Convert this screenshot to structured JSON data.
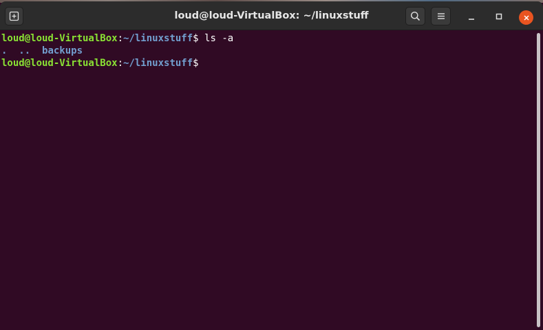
{
  "window": {
    "title": "loud@loud-VirtualBox: ~/linuxstuff"
  },
  "header": {
    "new_tab_icon": "new-tab-icon",
    "search_icon": "search-icon",
    "menu_icon": "hamburger-menu-icon",
    "minimize_icon": "minimize-icon",
    "maximize_icon": "maximize-icon",
    "close_icon": "close-icon"
  },
  "terminal": {
    "lines": [
      {
        "user_host": "loud@loud-VirtualBox",
        "colon": ":",
        "path": "~/linuxstuff",
        "dollar": "$",
        "command": " ls -a"
      },
      {
        "entries": [
          ".",
          "..",
          "backups"
        ]
      },
      {
        "user_host": "loud@loud-VirtualBox",
        "colon": ":",
        "path": "~/linuxstuff",
        "dollar": "$",
        "command": ""
      }
    ]
  },
  "colors": {
    "background": "#300a24",
    "prompt_user": "#8ae234",
    "prompt_path": "#729fcf",
    "directory": "#729fcf",
    "close_button": "#e95420",
    "titlebar": "#2c2c2c"
  }
}
